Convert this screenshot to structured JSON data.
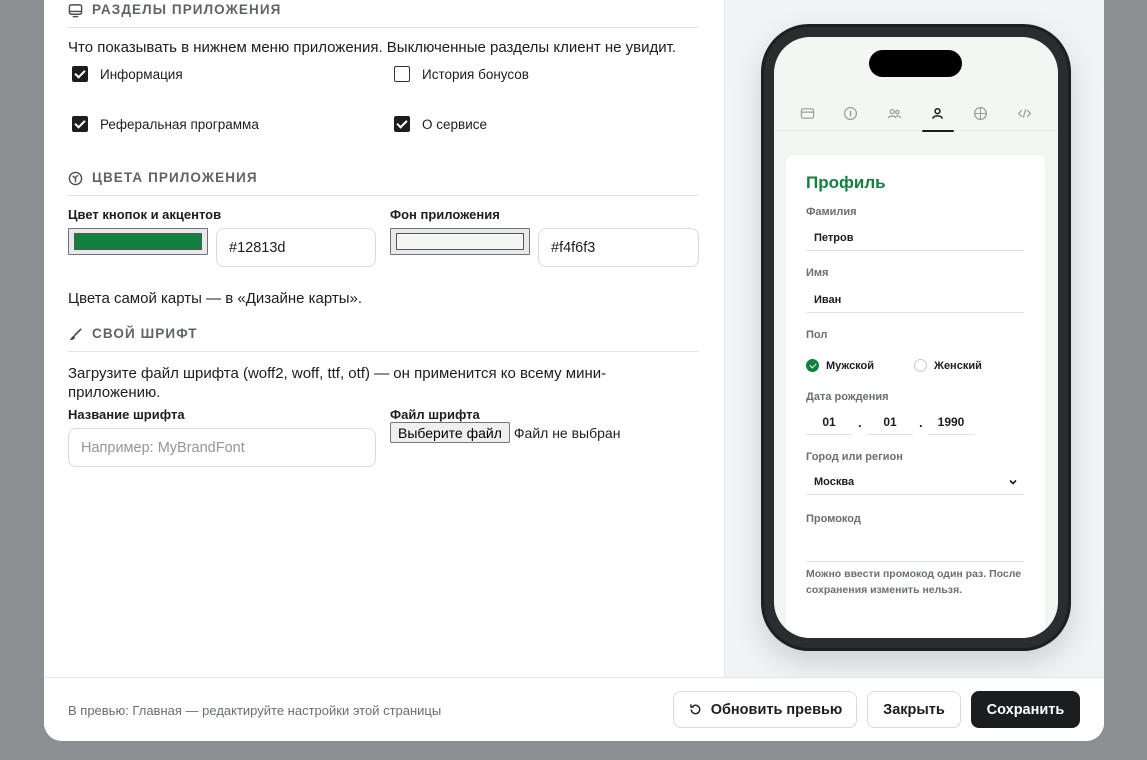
{
  "sections": {
    "app_sections": {
      "title": "РАЗДЕЛЫ ПРИЛОЖЕНИЯ",
      "icon": "monitor-icon",
      "description": "Что показывать в нижнем меню приложения. Выключенные разделы клиент не увидит.",
      "items": [
        {
          "label": "Информация",
          "checked": true
        },
        {
          "label": "История бонусов",
          "checked": false
        },
        {
          "label": "Реферальная программа",
          "checked": true
        },
        {
          "label": "О сервисе",
          "checked": true
        }
      ]
    },
    "app_colors": {
      "title": "ЦВЕТА ПРИЛОЖЕНИЯ",
      "icon": "palette-icon",
      "accent_label": "Цвет кнопок и акцентов",
      "accent_value": "#12813d",
      "background_label": "Фон приложения",
      "background_value": "#f4f6f3",
      "note": "Цвета самой карты — в «Дизайне карты»."
    },
    "custom_font": {
      "title": "СВОЙ ШРИФТ",
      "icon": "brush-icon",
      "description": "Загрузите файл шрифта (woff2, woff, ttf, otf) — он применится ко всему мини-приложению.",
      "name_label": "Название шрифта",
      "name_placeholder": "Например: MyBrandFont",
      "file_label": "Файл шрифта",
      "file_button": "Выберите файл",
      "file_status": "Файл не выбран"
    }
  },
  "preview": {
    "tabs": [
      "card-icon",
      "info-icon",
      "referral-icon",
      "profile-icon",
      "about-icon",
      "code-icon"
    ],
    "active_tab": 3,
    "profile": {
      "title": "Профиль",
      "surname_label": "Фамилия",
      "surname_value": "Петров",
      "name_label": "Имя",
      "name_value": "Иван",
      "gender_label": "Пол",
      "gender_male": "Мужской",
      "gender_female": "Женский",
      "gender_selected": "male",
      "birth_label": "Дата рождения",
      "birth_day": "01",
      "birth_month": "01",
      "birth_year": "1990",
      "date_sep": ".",
      "city_label": "Город или регион",
      "city_value": "Москва",
      "promo_label": "Промокод",
      "promo_value": "",
      "promo_hint": "Можно ввести промокод один раз. После сохранения изменить нельзя."
    }
  },
  "footer": {
    "note": "В превью: Главная — редактируйте настройки этой страницы",
    "refresh_label": "Обновить превью",
    "close_label": "Закрыть",
    "save_label": "Сохранить"
  }
}
